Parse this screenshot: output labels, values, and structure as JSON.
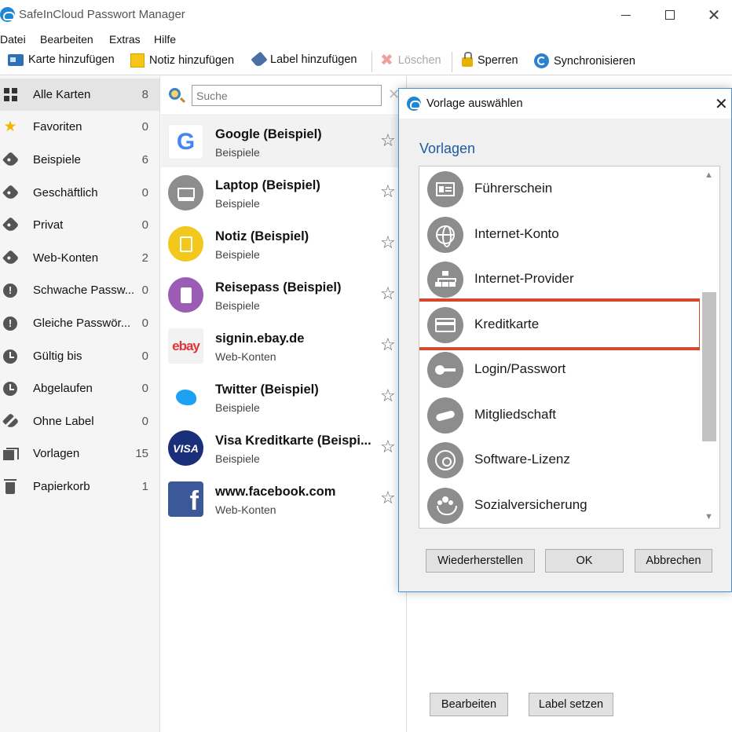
{
  "window": {
    "title": "SafeInCloud Passwort Manager"
  },
  "menu": [
    "Datei",
    "Bearbeiten",
    "Extras",
    "Hilfe"
  ],
  "toolbar": {
    "add_card": "Karte hinzufügen",
    "add_note": "Notiz hinzufügen",
    "add_label": "Label hinzufügen",
    "delete": "Löschen",
    "lock": "Sperren",
    "sync": "Synchronisieren"
  },
  "sidebar": {
    "items": [
      {
        "label": "Alle Karten",
        "count": "8",
        "icon": "grid-icon"
      },
      {
        "label": "Favoriten",
        "count": "0",
        "icon": "star-icon"
      },
      {
        "label": "Beispiele",
        "count": "6",
        "icon": "tag-icon"
      },
      {
        "label": "Geschäftlich",
        "count": "0",
        "icon": "tag-icon"
      },
      {
        "label": "Privat",
        "count": "0",
        "icon": "tag-icon"
      },
      {
        "label": "Web-Konten",
        "count": "2",
        "icon": "tag-icon"
      },
      {
        "label": "Schwache Passw...",
        "count": "0",
        "icon": "exclamation-icon"
      },
      {
        "label": "Gleiche Passwör...",
        "count": "0",
        "icon": "exclamation-icon"
      },
      {
        "label": "Gültig bis",
        "count": "0",
        "icon": "clock-icon"
      },
      {
        "label": "Abgelaufen",
        "count": "0",
        "icon": "clock-icon"
      },
      {
        "label": "Ohne Label",
        "count": "0",
        "icon": "no-label-icon"
      },
      {
        "label": "Vorlagen",
        "count": "15",
        "icon": "templates-icon"
      },
      {
        "label": "Papierkorb",
        "count": "1",
        "icon": "trash-icon"
      }
    ]
  },
  "search": {
    "placeholder": "Suche"
  },
  "cards": [
    {
      "title": "Google (Beispiel)",
      "label": "Beispiele",
      "logo": "G"
    },
    {
      "title": "Laptop (Beispiel)",
      "label": "Beispiele",
      "logo": "laptop-icon"
    },
    {
      "title": "Notiz (Beispiel)",
      "label": "Beispiele",
      "logo": "note-icon"
    },
    {
      "title": "Reisepass (Beispiel)",
      "label": "Beispiele",
      "logo": "passport-icon"
    },
    {
      "title": "signin.ebay.de",
      "label": "Web-Konten",
      "logo": "ebay"
    },
    {
      "title": "Twitter (Beispiel)",
      "label": "Beispiele",
      "logo": "twitter-icon"
    },
    {
      "title": "Visa Kreditkarte (Beispi...",
      "label": "Beispiele",
      "logo": "VISA"
    },
    {
      "title": "www.facebook.com",
      "label": "Web-Konten",
      "logo": "f"
    }
  ],
  "detail": {
    "edit_button": "Bearbeiten",
    "set_label_button": "Label setzen"
  },
  "dialog": {
    "title": "Vorlage auswählen",
    "heading": "Vorlagen",
    "templates": [
      {
        "label": "Führerschein",
        "icon": "id-card-icon"
      },
      {
        "label": "Internet-Konto",
        "icon": "globe-icon"
      },
      {
        "label": "Internet-Provider",
        "icon": "network-icon"
      },
      {
        "label": "Kreditkarte",
        "icon": "credit-card-icon"
      },
      {
        "label": "Login/Passwort",
        "icon": "key-icon"
      },
      {
        "label": "Mitgliedschaft",
        "icon": "handshake-icon"
      },
      {
        "label": "Software-Lizenz",
        "icon": "disc-icon"
      },
      {
        "label": "Sozialversicherung",
        "icon": "people-icon"
      }
    ],
    "selected_index": 3,
    "buttons": {
      "restore": "Wiederherstellen",
      "ok": "OK",
      "cancel": "Abbrechen"
    }
  },
  "colors": {
    "accent": "#1d5a9c",
    "highlight": "#d7472e",
    "brand": "#1e88d6"
  }
}
